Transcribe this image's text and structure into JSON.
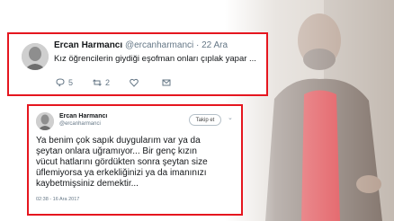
{
  "tweet1": {
    "name": "Ercan Harmancı",
    "handle": "@ercanharmanci",
    "date": "· 22 Ara",
    "text": "Kız öğrencilerin giydiği eşofman onları çıplak yapar ...",
    "replies": "5",
    "retweets": "2",
    "likes": "",
    "icons": [
      "reply-icon",
      "retweet-icon",
      "like-icon",
      "dm-icon"
    ]
  },
  "tweet2": {
    "name": "Ercan Harmancı",
    "handle": "@ercanharmanci",
    "follow_label": "Takip et",
    "lines": [
      "Ya benim çok sapık duygularım var ya da",
      "şeytan  onlara uğramıyor... Bir  genç kızın",
      "vücut hatlarını gördükten sonra şeytan size",
      "üflemiyorsa  ya erkekliğinizi ya da imanınızı",
      "kaybetmişsiniz demektir..."
    ],
    "timestamp": "02:38 - 16 Ara 2017"
  },
  "colors": {
    "highlight_border": "#e5161f",
    "photo_shirt": "#d8232a"
  }
}
